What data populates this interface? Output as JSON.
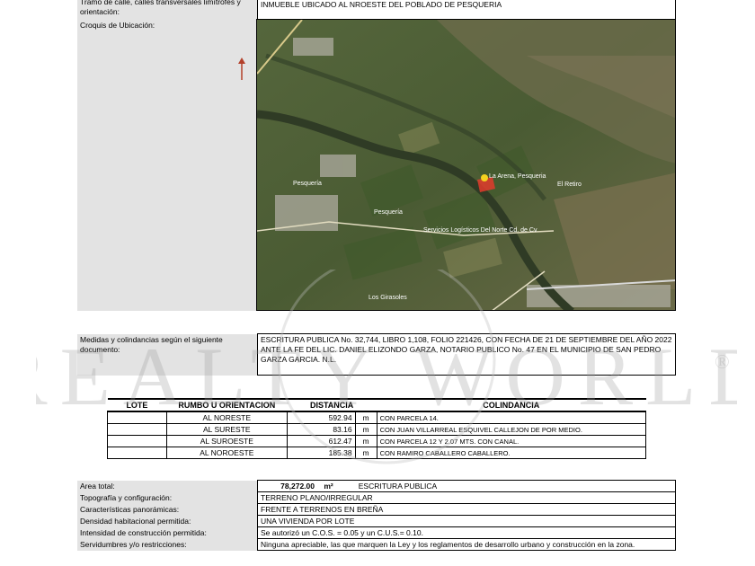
{
  "header": {
    "label": "Tramo de calle, calles transversales limítrofes y orientación:",
    "value": "INMUEBLE UBICADO AL NROESTE DEL POBLADO DE PESQUERIA"
  },
  "croquis": {
    "label": "Croquis de Ubicación:",
    "north_arrow": "arrow-up-icon",
    "map_labels": {
      "pin": "La Arena, Pesqueria",
      "retiro": "El Retiro",
      "pesqueria": "Pesquería",
      "town2": "Pesquería",
      "road": "Servicios Logísticos Del Norte Cd. de Cv",
      "girasoles": "Los Girasoles"
    }
  },
  "medidas": {
    "label": "Medidas y colindancias según el siguiente documento:",
    "value": "ESCRITURA PUBLICA No. 32,744, LIBRO 1,108, FOLIO 221426, CON FECHA DE 21 DE SEPTIEMBRE DEL AÑO 2022 ANTE LA FE DEL LIC. DANIEL ELIZONDO GARZA, NOTARIO PUBLICO No. 47 EN EL MUNICIPIO DE SAN PEDRO GARZA GARCIA. N.L."
  },
  "colindancias": {
    "headers": [
      "LOTE",
      "RUMBO U ORIENTACION",
      "DISTANCIA",
      "COLINDANCIA"
    ],
    "rows": [
      {
        "lote": "",
        "rumbo": "AL NORESTE",
        "distancia": "592.94",
        "unidad": "m",
        "colindancia": "CON PARCELA 14."
      },
      {
        "lote": "",
        "rumbo": "AL SURESTE",
        "distancia": "83.16",
        "unidad": "m",
        "colindancia": "CON JUAN VILLARREAL ESQUIVEL CALLEJON DE POR MEDIO."
      },
      {
        "lote": "",
        "rumbo": "AL SUROESTE",
        "distancia": "612.47",
        "unidad": "m",
        "colindancia": "CON PARCELA 12 Y 2.07 MTS. CON CANAL."
      },
      {
        "lote": "",
        "rumbo": "AL NOROESTE",
        "distancia": "185.38",
        "unidad": "m",
        "colindancia": "CON RAMIRO CABALLERO CABALLERO."
      }
    ]
  },
  "details": {
    "area_label": "Area total:",
    "area_value": "78,272.00",
    "area_unit": "m²",
    "area_source": "ESCRITURA PUBLICA",
    "rows": [
      {
        "label": "Topografía y configuración:",
        "value": "TERRENO PLANO/IRREGULAR"
      },
      {
        "label": "Características panorámicas:",
        "value": "FRENTE A TERRENOS EN BREÑA"
      },
      {
        "label": "Densidad habitacional permitida:",
        "value": "UNA VIVIENDA POR LOTE"
      },
      {
        "label": "Intensidad de construcción permitida:",
        "value": "Se autorizó un C.O.S. = 0.05 y un C.U.S.= 0.10."
      },
      {
        "label": "Servidumbres y/o restricciones:",
        "value": "Ninguna apreciable, las que marquen la Ley y los reglamentos de desarrollo urbano y construcción en la zona."
      }
    ]
  },
  "watermark": {
    "text": "REALTY WORLD",
    "registered": "®"
  },
  "colors": {
    "label_bg": "#e3e3e3",
    "map_green": "#4d5f34",
    "river": "#3f4e32",
    "pin": "#e23b2b"
  }
}
